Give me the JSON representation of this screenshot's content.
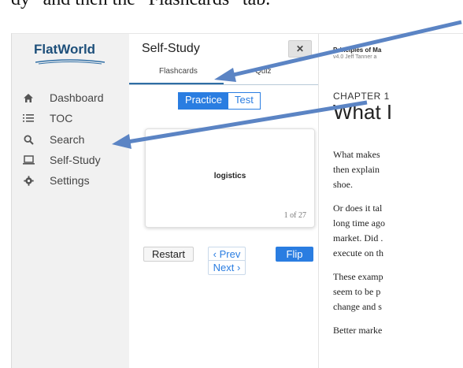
{
  "caption": {
    "text": "dy” and then the “Flashcards” tab."
  },
  "nav": {
    "logo": "FlatWorld",
    "items": [
      {
        "label": "Dashboard",
        "icon": "home-icon"
      },
      {
        "label": "TOC",
        "icon": "list-icon"
      },
      {
        "label": "Search",
        "icon": "search-icon"
      },
      {
        "label": "Self-Study",
        "icon": "laptop-icon"
      },
      {
        "label": "Settings",
        "icon": "gear-icon"
      }
    ]
  },
  "panel": {
    "title": "Self-Study",
    "close_label": "✕",
    "tabs": [
      {
        "label": "Flashcards"
      },
      {
        "label": "Quiz"
      }
    ],
    "modes": [
      {
        "label": "Practice"
      },
      {
        "label": "Test"
      }
    ],
    "card": {
      "term": "logistics",
      "count": "1 of 27"
    },
    "buttons": {
      "restart": "Restart",
      "prev": "‹ Prev",
      "next": "Next ›",
      "flip": "Flip"
    }
  },
  "reader": {
    "book_title": "Principles of Ma",
    "book_sub": "v4.0  Jeff Tanner a",
    "chapter_label": "CHAPTER 1",
    "chapter_title": "What I",
    "paragraphs": [
      [
        "What makes",
        "then explain",
        "shoe."
      ],
      [
        "Or does it tal",
        "long time ago",
        "market. Did .",
        "execute on th"
      ],
      [
        "These examp",
        "seem to be p",
        "change and s"
      ],
      [
        "Better marke"
      ]
    ]
  },
  "colors": {
    "accent": "#2a7de1",
    "arrow": "#5b84c4",
    "nav_bg": "#f1f1f1"
  }
}
